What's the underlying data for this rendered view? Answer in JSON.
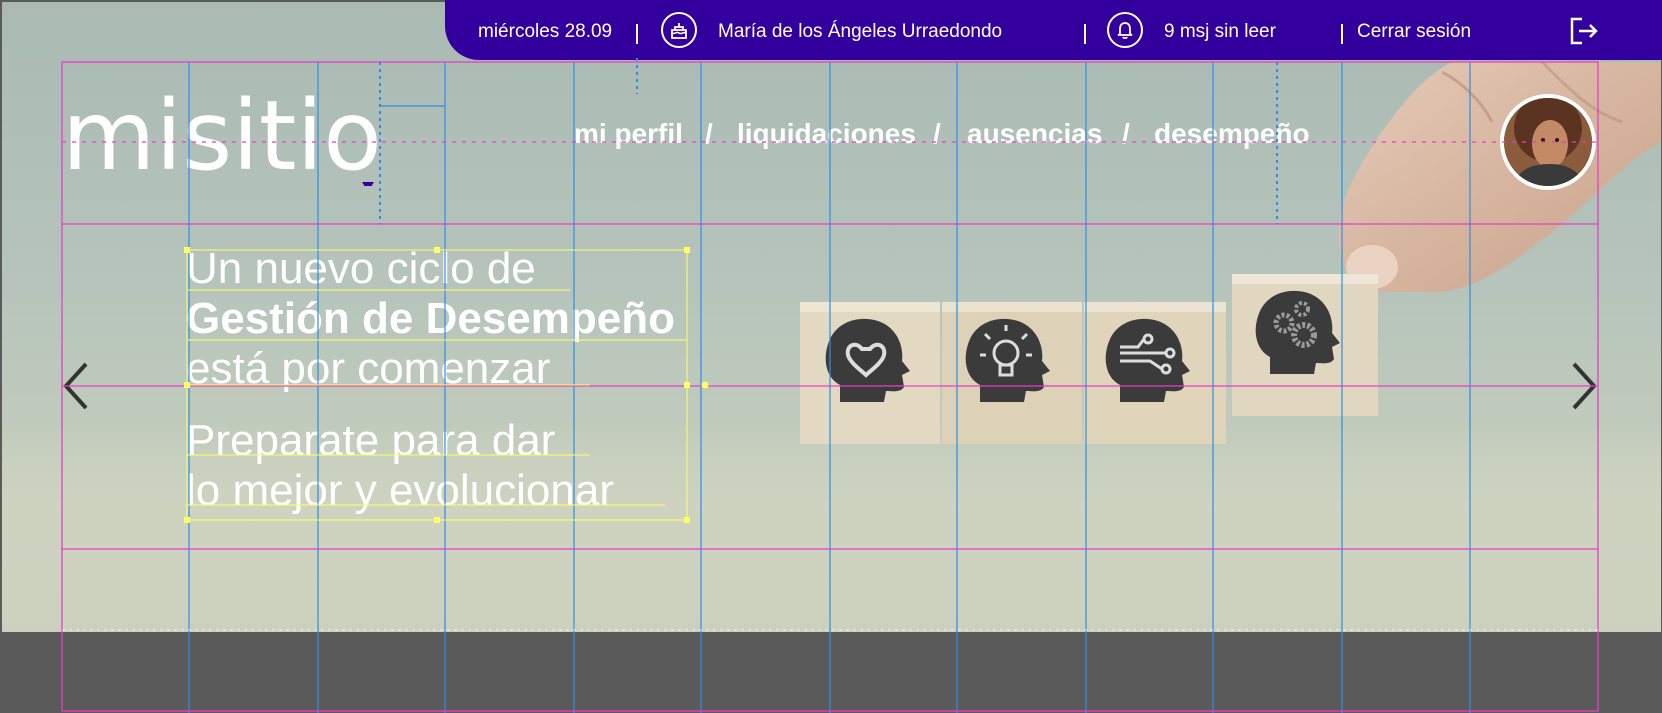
{
  "topbar": {
    "date": "miércoles 28.09",
    "user_name": "María de los Ángeles Urraedondo",
    "messages": "9 msj sin leer",
    "logout": "Cerrar sesión",
    "bg_color": "#33009e"
  },
  "brand": {
    "logo_text": "misitio"
  },
  "nav": {
    "items": [
      {
        "label": "mi perfil"
      },
      {
        "label": "liquidaciones"
      },
      {
        "label": "ausencias"
      },
      {
        "label": "desempeño"
      }
    ],
    "separator": "/"
  },
  "hero": {
    "title_line1": "Un nuevo ciclo de",
    "title_line2": "Gestión de Desempeño",
    "title_line3": "está por comenzar",
    "subtitle_line1": "Preparate para dar",
    "subtitle_line2": "lo mejor y evolucionar",
    "icons": [
      "heart-head-icon",
      "lightbulb-head-icon",
      "circuit-head-icon",
      "gears-head-icon"
    ]
  },
  "carousel": {
    "prev_icon": "chevron-left-icon",
    "next_icon": "chevron-right-icon"
  },
  "colors": {
    "accent": "#33009e",
    "grid_magenta": "#e83ec8",
    "grid_blue": "#2a8fe8",
    "guide_yellow": "#ffff66"
  }
}
